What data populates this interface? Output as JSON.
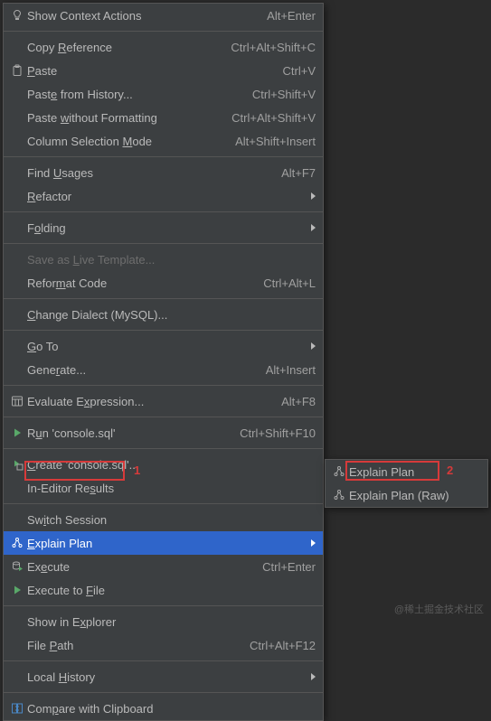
{
  "menu": {
    "items": [
      {
        "icon": "bulb",
        "label": "Show Context Actions",
        "shortcut": "Alt+Enter"
      },
      {
        "sep": true
      },
      {
        "label": "Copy <u>R</u>eference",
        "shortcut": "Ctrl+Alt+Shift+C"
      },
      {
        "icon": "paste",
        "label": "<u>P</u>aste",
        "shortcut": "Ctrl+V"
      },
      {
        "label": "Past<u>e</u> from History...",
        "shortcut": "Ctrl+Shift+V"
      },
      {
        "label": "Paste <u>w</u>ithout Formatting",
        "shortcut": "Ctrl+Alt+Shift+V"
      },
      {
        "label": "Column Selection <u>M</u>ode",
        "shortcut": "Alt+Shift+Insert"
      },
      {
        "sep": true
      },
      {
        "label": "Find <u>U</u>sages",
        "shortcut": "Alt+F7"
      },
      {
        "label": "<u>R</u>efactor",
        "submenu": true
      },
      {
        "sep": true
      },
      {
        "label": "F<u>o</u>lding",
        "submenu": true
      },
      {
        "sep": true
      },
      {
        "label": "Save as <u>L</u>ive Template...",
        "disabled": true
      },
      {
        "label": "Refor<u>m</u>at Code",
        "shortcut": "Ctrl+Alt+L"
      },
      {
        "sep": true
      },
      {
        "label": "<u>C</u>hange Dialect (MySQL)..."
      },
      {
        "sep": true
      },
      {
        "label": "<u>G</u>o To",
        "submenu": true
      },
      {
        "label": "Gene<u>r</u>ate...",
        "shortcut": "Alt+Insert"
      },
      {
        "sep": true
      },
      {
        "icon": "eval",
        "label": "Evaluate E<u>x</u>pression...",
        "shortcut": "Alt+F8"
      },
      {
        "sep": true
      },
      {
        "icon": "run",
        "label": "R<u>u</u>n 'console.sql'",
        "shortcut": "Ctrl+Shift+F10"
      },
      {
        "sep": true
      },
      {
        "icon": "config",
        "label": "<u>C</u>reate 'console.sql'..."
      },
      {
        "label": "In-Editor Re<u>s</u>ults"
      },
      {
        "sep": true
      },
      {
        "label": "Sw<u>i</u>tch Session"
      },
      {
        "icon": "plan",
        "label": "<u>E</u>xplain Plan",
        "submenu": true,
        "selected": true
      },
      {
        "icon": "exec",
        "label": "Ex<u>e</u>cute",
        "shortcut": "Ctrl+Enter"
      },
      {
        "icon": "run",
        "label": "Execute to <u>F</u>ile"
      },
      {
        "sep": true
      },
      {
        "label": "Show in E<u>x</u>plorer"
      },
      {
        "label": "File <u>P</u>ath",
        "shortcut": "Ctrl+Alt+F12"
      },
      {
        "sep": true
      },
      {
        "label": "Local <u>H</u>istory",
        "submenu": true
      },
      {
        "sep": true
      },
      {
        "icon": "compare",
        "label": "Com<u>p</u>are with Clipboard"
      }
    ]
  },
  "submenu": {
    "items": [
      {
        "icon": "plan",
        "label": "Explain Plan"
      },
      {
        "icon": "plan",
        "label": "Explain Plan (Raw)"
      }
    ]
  },
  "annotations": {
    "num1": "1",
    "num2": "2"
  },
  "watermark": "@稀土掘金技术社区"
}
